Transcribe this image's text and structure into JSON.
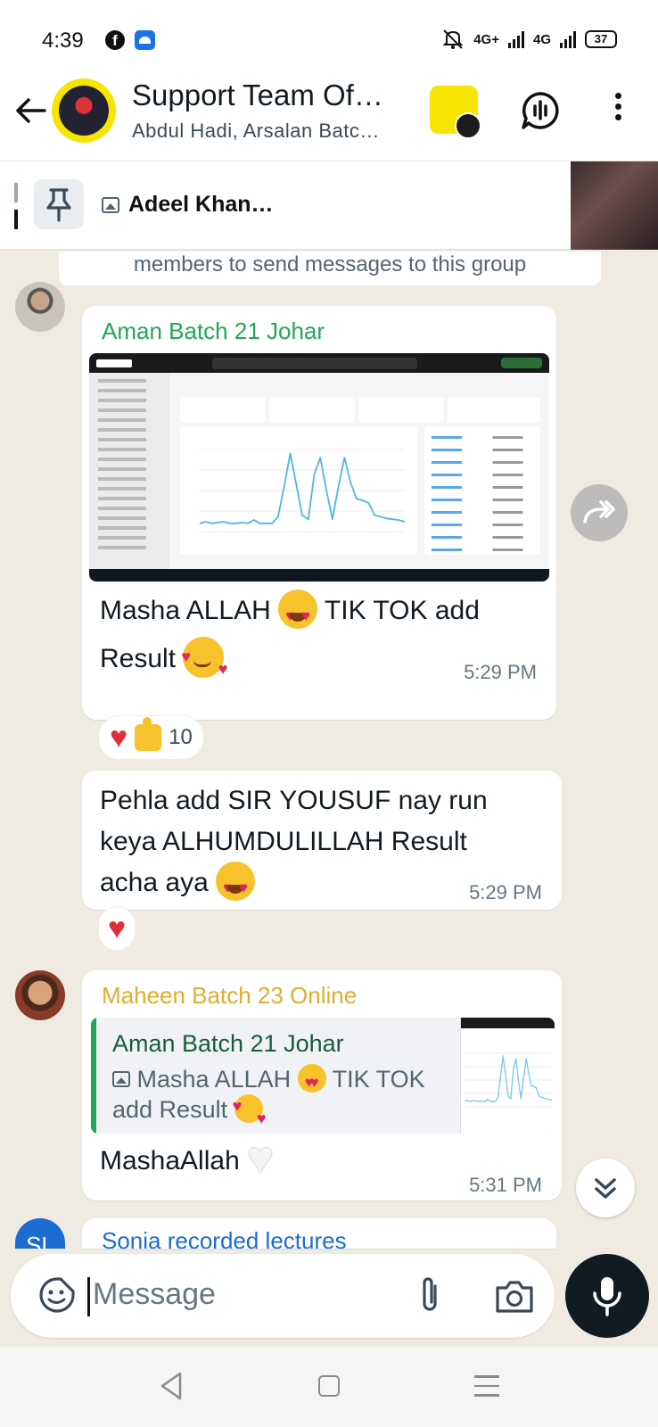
{
  "status_bar": {
    "time": "4:39",
    "network1": "4G+",
    "network2": "4G",
    "battery": "37"
  },
  "header": {
    "title": "Support Team Of…",
    "subtitle": "Abdul Hadi, Arsalan Batc…"
  },
  "pinned": {
    "label": "Adeel Khan…"
  },
  "system_note": "members to send messages to this group",
  "messages": [
    {
      "sender": "Aman Batch 21 Johar",
      "text_a": "Masha ALLAH",
      "text_b": "TIK TOK add",
      "text_c": "Result",
      "time": "5:29 PM",
      "reaction_count": "10"
    },
    {
      "text_a": "Pehla add SIR YOUSUF nay run",
      "text_b": "keya ALHUMDULILLAH Result",
      "text_c": "acha aya",
      "time": "5:29 PM"
    },
    {
      "sender": "Maheen Batch 23 Online",
      "quote_name": "Aman Batch 21 Johar",
      "quote_a": "Masha ALLAH",
      "quote_b": "TIK TOK",
      "quote_c": "add Result",
      "text": "MashaAllah",
      "time": "5:31 PM"
    },
    {
      "sender": "Sonia recorded lectures",
      "avatar_initials": "SL"
    }
  ],
  "screenshot": {
    "chart_data": {
      "type": "line",
      "values": [
        0.1,
        0.12,
        0.1,
        0.11,
        0.12,
        0.1,
        0.1,
        0.11,
        0.1,
        0.14,
        0.1,
        0.1,
        0.1,
        0.18,
        0.55,
        0.95,
        0.58,
        0.2,
        0.15,
        0.7,
        0.9,
        0.5,
        0.15,
        0.55,
        0.9,
        0.6,
        0.4,
        0.38,
        0.35,
        0.2,
        0.18,
        0.16,
        0.15,
        0.14,
        0.12
      ]
    }
  },
  "input": {
    "placeholder": "Message"
  },
  "colors": {
    "green_sender": "#1fa855",
    "yellow_sender": "#e0ad2e",
    "blue_sender": "#1b6dd1",
    "chat_bg": "#efeae2"
  }
}
